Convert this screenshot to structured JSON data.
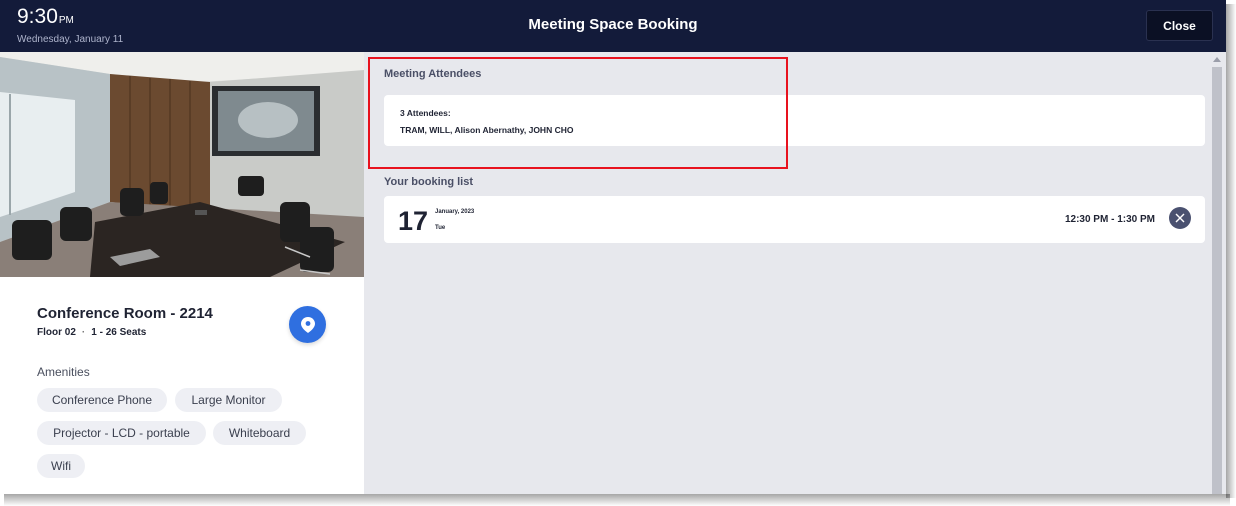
{
  "header": {
    "time": "9:30",
    "ampm": "PM",
    "date": "Wednesday, January 11",
    "title": "Meeting Space Booking",
    "close_label": "Close"
  },
  "room": {
    "name": "Conference Room - 2214",
    "floor": "Floor 02",
    "separator": "·",
    "seats": "1 - 26 Seats",
    "amenities_label": "Amenities",
    "amenities": [
      "Conference Phone",
      "Large Monitor",
      "Projector - LCD - portable",
      "Whiteboard",
      "Wifi"
    ]
  },
  "attendees": {
    "section_label": "Meeting Attendees",
    "count_text": "3 Attendees:",
    "names": "TRAM, WILL, Alison Abernathy, JOHN CHO"
  },
  "bookings": {
    "section_label": "Your booking list",
    "items": [
      {
        "day": "17",
        "month_year": "January, 2023",
        "weekday": "Tue",
        "time_range": "12:30 PM - 1:30 PM"
      }
    ]
  },
  "colors": {
    "header_bg": "#131b3a",
    "accent_blue": "#2f6fe0",
    "highlight_red": "#e8121e",
    "content_bg": "#e7e8ed"
  },
  "icons": {
    "location": "map-pin-icon",
    "cancel": "close-circle-icon",
    "scroll": "scroll-up-arrow-icon"
  }
}
